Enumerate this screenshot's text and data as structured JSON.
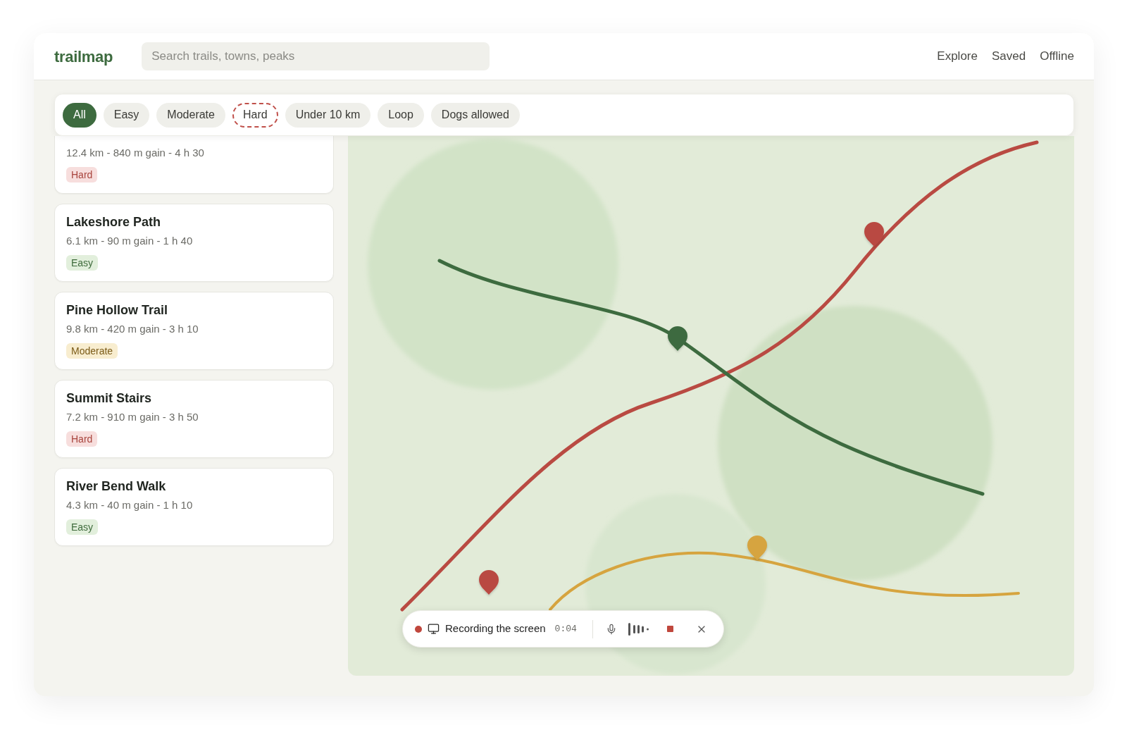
{
  "header": {
    "logo": "trailmap",
    "search": {
      "placeholder": "Search trails, towns, peaks"
    },
    "nav": [
      "Explore",
      "Saved",
      "Offline"
    ]
  },
  "filters": [
    {
      "label": "All",
      "selected": true,
      "focused": false
    },
    {
      "label": "Easy",
      "selected": false,
      "focused": false
    },
    {
      "label": "Moderate",
      "selected": false,
      "focused": false
    },
    {
      "label": "Hard",
      "selected": false,
      "focused": true
    },
    {
      "label": "Under 10 km",
      "selected": false,
      "focused": false
    },
    {
      "label": "Loop",
      "selected": false,
      "focused": false
    },
    {
      "label": "Dogs allowed",
      "selected": false,
      "focused": false
    }
  ],
  "trails": [
    {
      "meta": "12.4 km - 840 m gain - 4 h 30",
      "badge": {
        "label": "Hard",
        "kind": "hard"
      }
    },
    {
      "title": "Lakeshore Path",
      "meta": "6.1 km - 90 m gain - 1 h 40",
      "badge": {
        "label": "Easy",
        "kind": "easy"
      }
    },
    {
      "title": "Pine Hollow Trail",
      "meta": "9.8 km - 420 m gain - 3 h 10",
      "badge": {
        "label": "Moderate",
        "kind": "moderate"
      }
    },
    {
      "title": "Summit Stairs",
      "meta": "7.2 km - 910 m gain - 3 h 50",
      "badge": {
        "label": "Hard",
        "kind": "hard"
      }
    },
    {
      "title": "River Bend Walk",
      "meta": "4.3 km - 40 m gain - 1 h 10",
      "badge": {
        "label": "Easy",
        "kind": "easy"
      }
    }
  ],
  "recording": {
    "label": "Recording the screen",
    "time": "0:04"
  }
}
